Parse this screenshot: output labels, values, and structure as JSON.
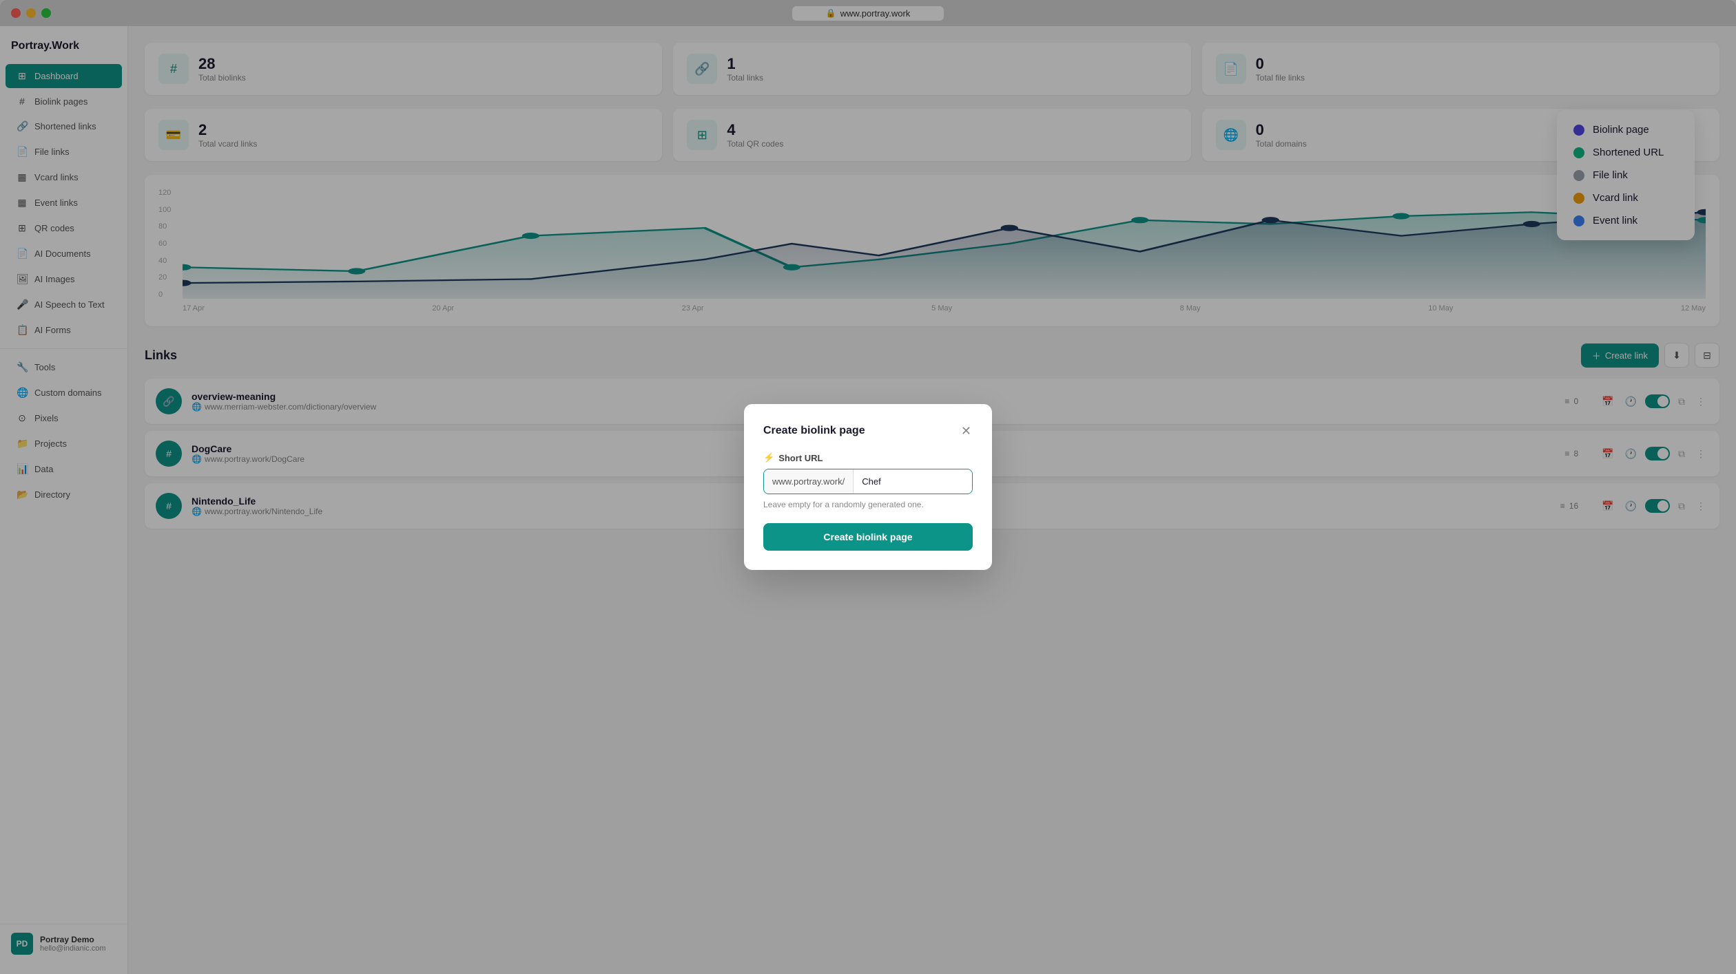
{
  "window": {
    "title": "www.portray.work"
  },
  "sidebar": {
    "logo": "Portray.Work",
    "items": [
      {
        "id": "dashboard",
        "label": "Dashboard",
        "icon": "⊞",
        "active": true
      },
      {
        "id": "biolink-pages",
        "label": "Biolink pages",
        "icon": "#"
      },
      {
        "id": "shortened-links",
        "label": "Shortened links",
        "icon": "🔗"
      },
      {
        "id": "file-links",
        "label": "File links",
        "icon": "📄"
      },
      {
        "id": "vcard-links",
        "label": "Vcard links",
        "icon": "▦"
      },
      {
        "id": "event-links",
        "label": "Event links",
        "icon": "▦"
      },
      {
        "id": "qr-codes",
        "label": "QR codes",
        "icon": "⊞"
      },
      {
        "id": "ai-documents",
        "label": "AI Documents",
        "icon": "📄"
      },
      {
        "id": "ai-images",
        "label": "AI Images",
        "icon": "🖼"
      },
      {
        "id": "ai-speech",
        "label": "AI Speech to Text",
        "icon": "🎤"
      },
      {
        "id": "ai-forms",
        "label": "AI Forms",
        "icon": "📋"
      },
      {
        "id": "tools",
        "label": "Tools",
        "icon": "🔧"
      },
      {
        "id": "custom-domains",
        "label": "Custom domains",
        "icon": "🌐"
      },
      {
        "id": "pixels",
        "label": "Pixels",
        "icon": "⊙"
      },
      {
        "id": "projects",
        "label": "Projects",
        "icon": "📁"
      },
      {
        "id": "data",
        "label": "Data",
        "icon": "📊"
      },
      {
        "id": "directory",
        "label": "Directory",
        "icon": "📂"
      }
    ],
    "user": {
      "name": "Portray Demo",
      "email": "hello@indianic.com",
      "initials": "PD"
    }
  },
  "stats": [
    {
      "icon": "#",
      "value": "28",
      "label": "Total biolinks"
    },
    {
      "icon": "🔗",
      "value": "1",
      "label": "Total links"
    },
    {
      "icon": "📄",
      "value": "0",
      "label": "Total file links"
    },
    {
      "icon": "💳",
      "value": "2",
      "label": "Total vcard links"
    },
    {
      "icon": "⊞",
      "value": "4",
      "label": "Total QR codes"
    },
    {
      "icon": "🌐",
      "value": "0",
      "label": "Total domains"
    }
  ],
  "chart": {
    "y_labels": [
      "120",
      "100",
      "80",
      "60",
      "40",
      "20",
      "0"
    ],
    "x_labels": [
      "17 Apr",
      "20 Apr",
      "23 Apr",
      "5 May",
      "8 May",
      "10 May",
      "12 May"
    ]
  },
  "links_section": {
    "title": "Links",
    "create_button": "Create link",
    "items": [
      {
        "id": "overview-meaning",
        "name": "overview-meaning",
        "url": "www.merriam-webster.com/dictionary/overview",
        "clicks": "0",
        "icon_type": "teal",
        "icon": "#"
      },
      {
        "id": "dogcare",
        "name": "DogCare",
        "url": "www.portray.work/DogCare",
        "clicks": "8",
        "icon_type": "teal",
        "icon": "#"
      },
      {
        "id": "nintendo-life",
        "name": "Nintendo_Life",
        "url": "www.portray.work/Nintendo_Life",
        "clicks": "16",
        "icon_type": "teal",
        "icon": "#"
      }
    ]
  },
  "modal": {
    "title": "Create biolink page",
    "short_url_label": "Short URL",
    "url_prefix": "www.portray.work/",
    "url_value": "Chef",
    "hint": "Leave empty for a randomly generated one.",
    "create_button": "Create biolink page"
  },
  "legend": {
    "items": [
      {
        "label": "Biolink page",
        "color": "#4f46e5"
      },
      {
        "label": "Shortened URL",
        "color": "#10b981"
      },
      {
        "label": "File link",
        "color": "#9ca3af"
      },
      {
        "label": "Vcard link",
        "color": "#f59e0b"
      },
      {
        "label": "Event link",
        "color": "#3b82f6"
      }
    ]
  }
}
